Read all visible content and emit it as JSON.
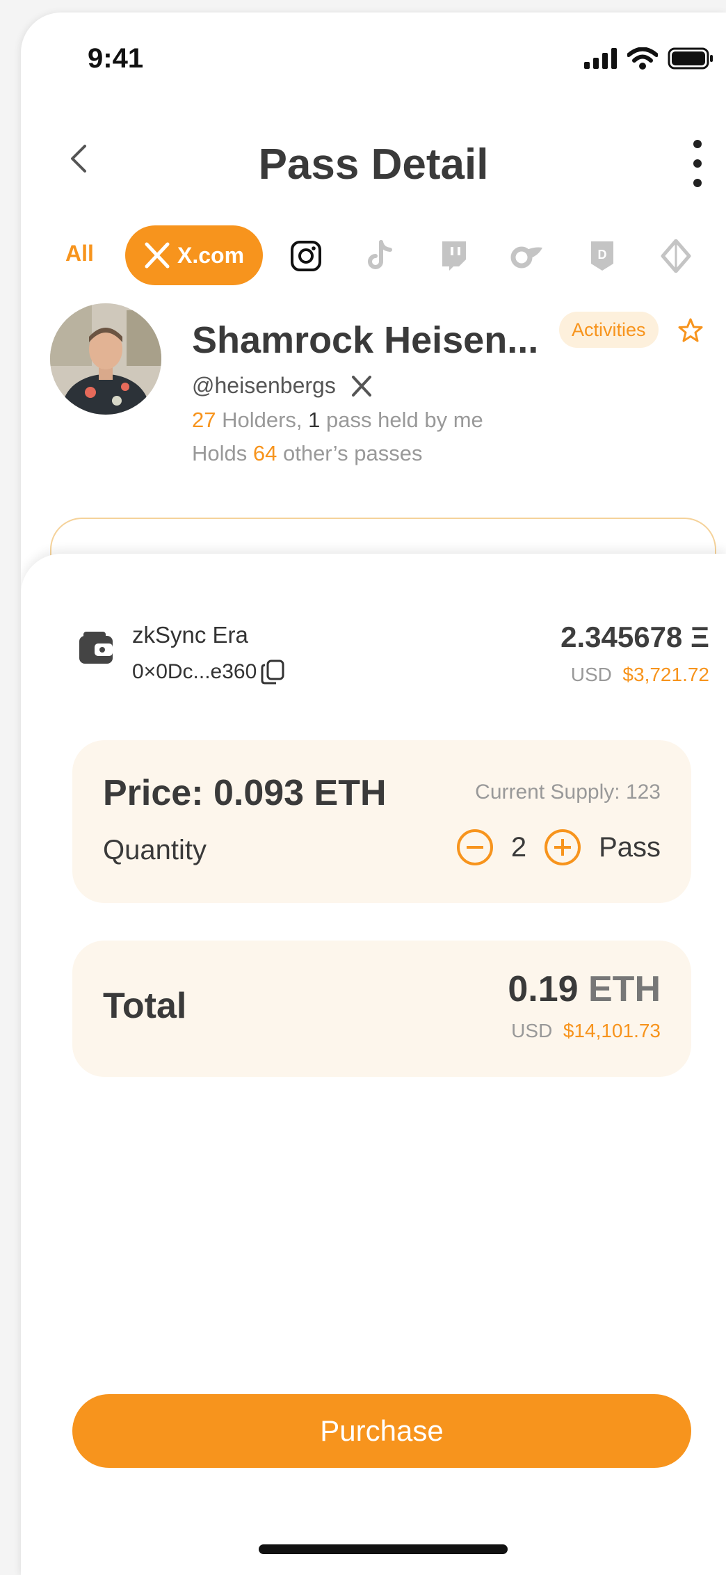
{
  "status_bar": {
    "time": "9:41"
  },
  "header": {
    "title": "Pass Detail"
  },
  "tabs": {
    "all_label": "All",
    "active_label": "X.com",
    "icons": [
      "instagram-icon",
      "tiktok-icon",
      "twitch-icon",
      "onlyfans-icon",
      "discord-icon",
      "ens-icon"
    ]
  },
  "profile": {
    "name": "Shamrock Heisen...",
    "handle": "@heisenbergs",
    "activities_label": "Activities",
    "holders_count": "27",
    "holders_text": " Holders, ",
    "held_by_me_count": "1",
    "held_by_me_text": " pass held by me",
    "holds_prefix": "Holds ",
    "holds_count": "64",
    "holds_suffix": " other’s passes"
  },
  "wallet": {
    "network": "zkSync Era",
    "address": "0×0Dc...e360",
    "balance": "2.345678 Ξ",
    "usd_label": "USD",
    "usd_value": "$3,721.72"
  },
  "price_card": {
    "price_label": "Price: 0.093 ETH",
    "supply_label": "Current Supply: 123",
    "quantity_label": "Quantity",
    "quantity_value": "2",
    "unit_label": "Pass"
  },
  "total_card": {
    "label": "Total",
    "amount": "0.19",
    "unit": "ETH",
    "usd_label": "USD",
    "usd_value": "$14,101.73"
  },
  "actions": {
    "purchase_label": "Purchase"
  },
  "colors": {
    "accent": "#f7941d",
    "card_bg": "#fdf6ec",
    "text_dark": "#3a3a3a"
  }
}
